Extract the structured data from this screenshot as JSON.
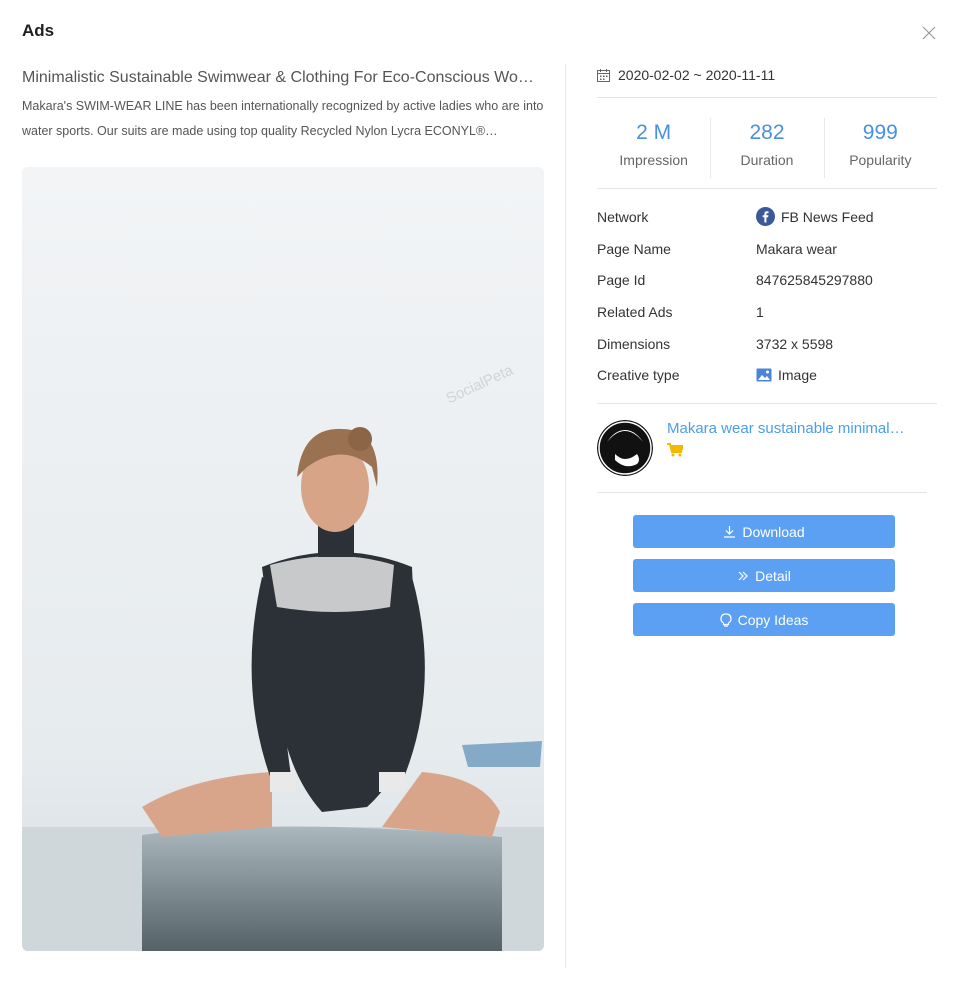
{
  "modal": {
    "title": "Ads"
  },
  "ad": {
    "title": "Minimalistic Sustainable Swimwear & Clothing For Eco-Conscious Women",
    "description": "Makara's SWIM-WEAR LINE has been internationally recognized by active ladies who are into water sports. Our suits are made using top quality Recycled Nylon Lycra ECONYL® regenerated nylon.",
    "watermark": "SocialPeta"
  },
  "date_range": "2020-02-02 ~ 2020-11-11",
  "stats": [
    {
      "value": "2 M",
      "label": "Impression"
    },
    {
      "value": "282",
      "label": "Duration"
    },
    {
      "value": "999",
      "label": "Popularity"
    }
  ],
  "info": [
    {
      "key": "Network",
      "value": "FB News Feed",
      "icon": "facebook-icon"
    },
    {
      "key": "Page Name",
      "value": "Makara wear",
      "icon": ""
    },
    {
      "key": "Page Id",
      "value": "847625845297880",
      "icon": ""
    },
    {
      "key": "Related Ads",
      "value": "1",
      "icon": ""
    },
    {
      "key": "Dimensions",
      "value": "3732 x 5598",
      "icon": ""
    },
    {
      "key": "Creative type",
      "value": "Image",
      "icon": "image-icon"
    }
  ],
  "advertiser": {
    "name": "Makara wear sustainable minimalistic swimwear"
  },
  "actions": {
    "download": "Download",
    "detail": "Detail",
    "copy_ideas": "Copy Ideas"
  },
  "colors": {
    "accent": "#4a90e2",
    "button": "#5ba0f2",
    "link": "#4a9fe8",
    "cart": "#f5b800",
    "facebook": "#3b5998"
  }
}
